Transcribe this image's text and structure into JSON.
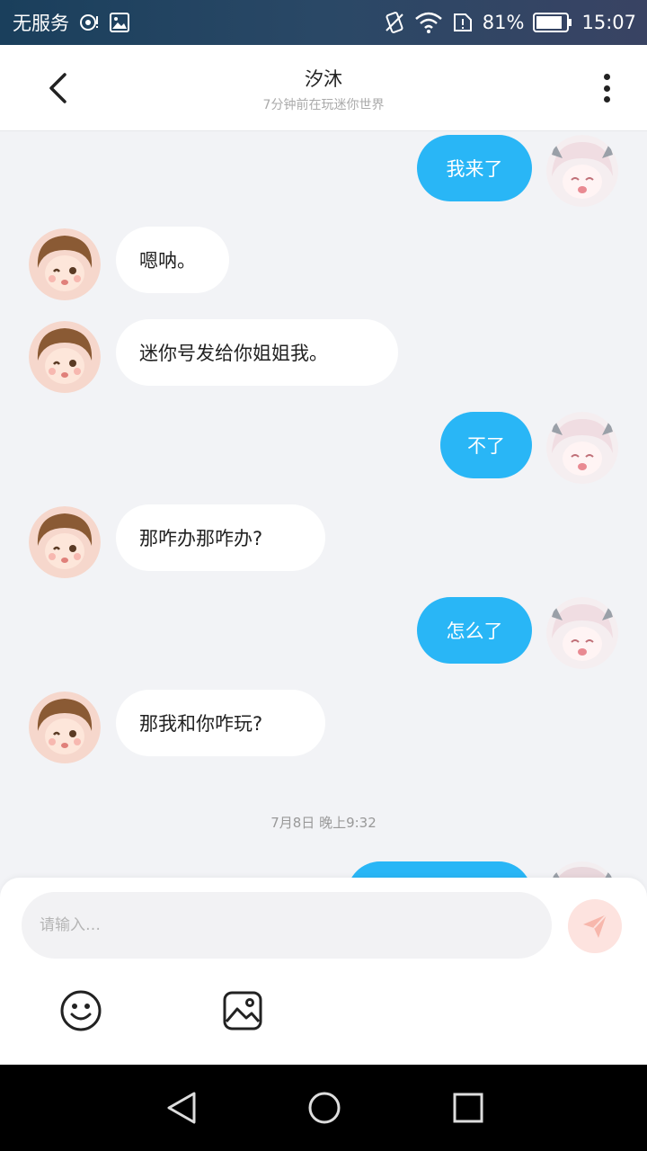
{
  "status_bar": {
    "carrier": "无服务",
    "battery": "81%",
    "time": "15:07"
  },
  "header": {
    "title": "汐沐",
    "subtitle": "7分钟前在玩迷你世界",
    "icons": {
      "back": "chevron-left-icon",
      "more": "more-vertical-icon"
    }
  },
  "messages": [
    {
      "side": "out",
      "text": "我来了"
    },
    {
      "side": "in",
      "text": "嗯呐。"
    },
    {
      "side": "in",
      "text": "迷你号发给你姐姐我。"
    },
    {
      "side": "out",
      "text": "不了"
    },
    {
      "side": "in",
      "text": "那咋办那咋办?"
    },
    {
      "side": "out",
      "text": "怎么了"
    },
    {
      "side": "in",
      "text": "那我和你咋玩?"
    }
  ],
  "timestamp": "7月8日 晚上9:32",
  "input": {
    "placeholder": "请输入…"
  },
  "colors": {
    "accent": "#29b6f6",
    "send_bg": "#fde3df",
    "send_icon": "#f7b7ac",
    "chat_bg": "#f2f3f6"
  },
  "toolbar_icons": [
    "smile-icon",
    "image-icon"
  ],
  "nav_icons": [
    "back-triangle-icon",
    "home-circle-icon",
    "recents-square-icon"
  ]
}
